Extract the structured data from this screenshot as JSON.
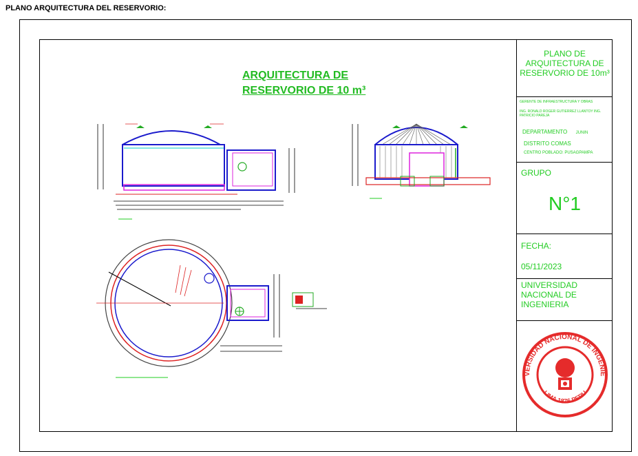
{
  "caption": "PLANO ARQUITECTURA DEL RESERVORIO:",
  "drawing": {
    "title_line1": "ARQUITECTURA DE",
    "title_line2": "RESERVORIO DE 10 m³"
  },
  "title_block": {
    "plan_title": "PLANO DE ARQUITECTURA DE RESERVORIO DE 10m³",
    "manager_role": "GERENTE DE INFRAESTRUCTURA Y OBRAS",
    "engineers": "ING. RONALD ROGER GUTIERREZ LLANTOY ING. PATRICIO PAREJA",
    "departamento_label": "DEPARTAMENTO",
    "departamento_value": "JUNIN",
    "distrito": "DISTRITO COMAS",
    "centro_poblado": "CENTRO POBLADO: PUSAGPAMPA",
    "grupo_label": "GRUPO",
    "grupo_value": "N°1",
    "fecha_label": "FECHA:",
    "fecha_value": "05/11/2023",
    "university": "UNIVERSIDAD NACIONAL DE INGENIERIA",
    "seal_text": "UNIVERSIDAD NACIONAL DE INGENIERIA",
    "seal_bottom": "LIMA 1876 PERU"
  },
  "colors": {
    "accent_green": "#22cc22",
    "seal_red": "#e52b2b",
    "line_blue": "#1a1acc",
    "line_red": "#dd2222",
    "line_magenta": "#dd22dd"
  }
}
